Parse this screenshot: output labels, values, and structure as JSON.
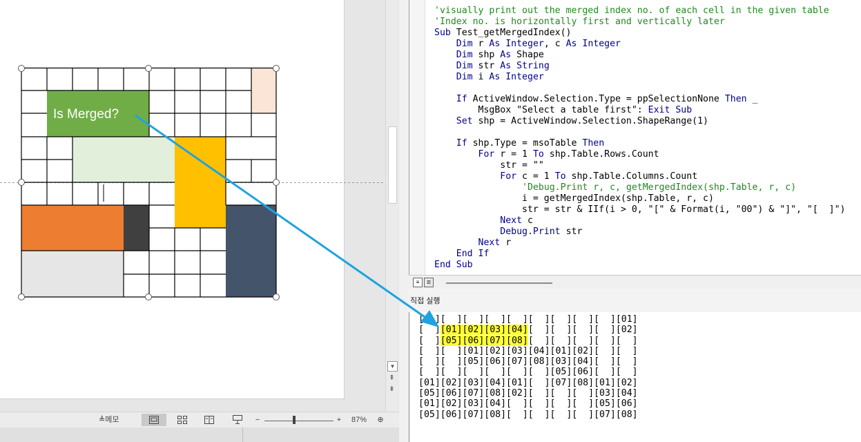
{
  "slide": {
    "callout_text": "Is Merged?"
  },
  "statusbar": {
    "notes_label": "메모",
    "zoom_out": "−",
    "zoom_in": "+",
    "zoom_level": "87%"
  },
  "code": {
    "lines": [
      [
        {
          "t": "'visually print out the merged index no. of each cell in the given table",
          "c": "cm"
        }
      ],
      [
        {
          "t": "'Index no. is horizontally first and vertically later",
          "c": "cm"
        }
      ],
      [
        {
          "t": "Sub",
          "c": "kw"
        },
        {
          "t": " Test_getMergedIndex()"
        }
      ],
      [
        {
          "t": "    "
        },
        {
          "t": "Dim",
          "c": "kw"
        },
        {
          "t": " r "
        },
        {
          "t": "As Integer",
          "c": "kw"
        },
        {
          "t": ", c "
        },
        {
          "t": "As Integer",
          "c": "kw"
        }
      ],
      [
        {
          "t": "    "
        },
        {
          "t": "Dim",
          "c": "kw"
        },
        {
          "t": " shp "
        },
        {
          "t": "As",
          "c": "kw"
        },
        {
          "t": " Shape"
        }
      ],
      [
        {
          "t": "    "
        },
        {
          "t": "Dim",
          "c": "kw"
        },
        {
          "t": " str "
        },
        {
          "t": "As String",
          "c": "kw"
        }
      ],
      [
        {
          "t": "    "
        },
        {
          "t": "Dim",
          "c": "kw"
        },
        {
          "t": " i "
        },
        {
          "t": "As Integer",
          "c": "kw"
        }
      ],
      [
        {
          "t": ""
        }
      ],
      [
        {
          "t": "    "
        },
        {
          "t": "If",
          "c": "kw"
        },
        {
          "t": " ActiveWindow.Selection.Type = ppSelectionNone "
        },
        {
          "t": "Then",
          "c": "kw"
        },
        {
          "t": " _"
        }
      ],
      [
        {
          "t": "        MsgBox \"Select a table first\": "
        },
        {
          "t": "Exit Sub",
          "c": "kw"
        }
      ],
      [
        {
          "t": "    "
        },
        {
          "t": "Set",
          "c": "kw"
        },
        {
          "t": " shp = ActiveWindow.Selection.ShapeRange(1)"
        }
      ],
      [
        {
          "t": ""
        }
      ],
      [
        {
          "t": "    "
        },
        {
          "t": "If",
          "c": "kw"
        },
        {
          "t": " shp.Type = msoTable "
        },
        {
          "t": "Then",
          "c": "kw"
        }
      ],
      [
        {
          "t": "        "
        },
        {
          "t": "For",
          "c": "kw"
        },
        {
          "t": " r = 1 "
        },
        {
          "t": "To",
          "c": "kw"
        },
        {
          "t": " shp.Table.Rows.Count"
        }
      ],
      [
        {
          "t": "            str = \"\""
        }
      ],
      [
        {
          "t": "            "
        },
        {
          "t": "For",
          "c": "kw"
        },
        {
          "t": " c = 1 "
        },
        {
          "t": "To",
          "c": "kw"
        },
        {
          "t": " shp.Table.Columns.Count"
        }
      ],
      [
        {
          "t": "                "
        },
        {
          "t": "'Debug.Print r, c, getMergedIndex(shp.Table, r, c)",
          "c": "cm"
        }
      ],
      [
        {
          "t": "                i = getMergedIndex(shp.Table, r, c)"
        }
      ],
      [
        {
          "t": "                str = str & IIf(i > 0, \"[\" & Format(i, \"00\") & \"]\", \"[  ]\")"
        }
      ],
      [
        {
          "t": "            "
        },
        {
          "t": "Next",
          "c": "kw"
        },
        {
          "t": " c"
        }
      ],
      [
        {
          "t": "            "
        },
        {
          "t": "Debug.Print",
          "c": "kw"
        },
        {
          "t": " str"
        }
      ],
      [
        {
          "t": "        "
        },
        {
          "t": "Next",
          "c": "kw"
        },
        {
          "t": " r"
        }
      ],
      [
        {
          "t": "    "
        },
        {
          "t": "End If",
          "c": "kw"
        }
      ],
      [
        {
          "t": "End Sub",
          "c": "kw"
        }
      ]
    ]
  },
  "immediate": {
    "title": "직접 실행",
    "lines": [
      [
        {
          "t": "[  ][  ][  ][  ][  ][  ][  ][  ][  ][01]"
        }
      ],
      [
        {
          "t": "[  ]"
        },
        {
          "t": "[01][02][03][04]",
          "hl": true
        },
        {
          "t": "[  ][  ][  ][  ][02]"
        }
      ],
      [
        {
          "t": "[  ]"
        },
        {
          "t": "[05][06][07][08]",
          "hl": true
        },
        {
          "t": "[  ][  ][  ][  ][  ]"
        }
      ],
      [
        {
          "t": "[  ][  ][01][02][03][04][01][02][  ][  ]"
        }
      ],
      [
        {
          "t": "[  ][  ][05][06][07][08][03][04][  ][  ]"
        }
      ],
      [
        {
          "t": "[  ][  ][  ][  ][  ][  ][05][06][  ][  ]"
        }
      ],
      [
        {
          "t": "[01][02][03][04][01][  ][07][08][01][02]"
        }
      ],
      [
        {
          "t": "[05][06][07][08][02][  ][  ][  ][03][04]"
        }
      ],
      [
        {
          "t": "[01][02][03][04][  ][  ][  ][  ][05][06]"
        }
      ],
      [
        {
          "t": "[05][06][07][08][  ][  ][  ][  ][07][08]"
        }
      ]
    ]
  },
  "colors": {
    "green_cell": "#70ad47",
    "light_green_cell": "#e2efda",
    "yellow_cell": "#ffc000",
    "peach_cell": "#fbe5d6",
    "orange_cell": "#ed7d31",
    "dark_gray_cell": "#404040",
    "navy_cell": "#44546a",
    "light_gray_cell": "#e7e6e6",
    "arrow": "#1fa3e0",
    "highlight": "#ffff33"
  },
  "icons": {
    "notes": "notes-icon",
    "normal_view": "normal-view-icon",
    "slide_sorter": "slide-sorter-icon",
    "reading_view": "reading-view-icon",
    "slideshow": "slideshow-icon",
    "fit": "fit-to-window-icon"
  }
}
